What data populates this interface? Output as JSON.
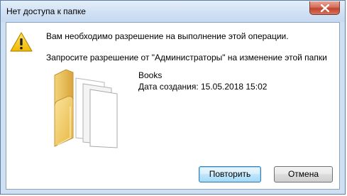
{
  "window": {
    "title": "Нет доступа к папке"
  },
  "message": {
    "main": "Вам необходимо разрешение на выполнение этой операции.",
    "detail": "Запросите разрешение от \"Администраторы\" на изменение этой папки"
  },
  "folder": {
    "name": "Books",
    "date": "Дата создания: 15.05.2018 15:02"
  },
  "buttons": {
    "retry": "Повторить",
    "cancel": "Отмена"
  },
  "icons": {
    "close": "close-icon",
    "warning": "warning-icon",
    "folder": "folder-icon"
  },
  "colors": {
    "titlebar": "#d2e2f5",
    "close_button": "#c2432c",
    "default_button_border": "#3c7fb1"
  }
}
